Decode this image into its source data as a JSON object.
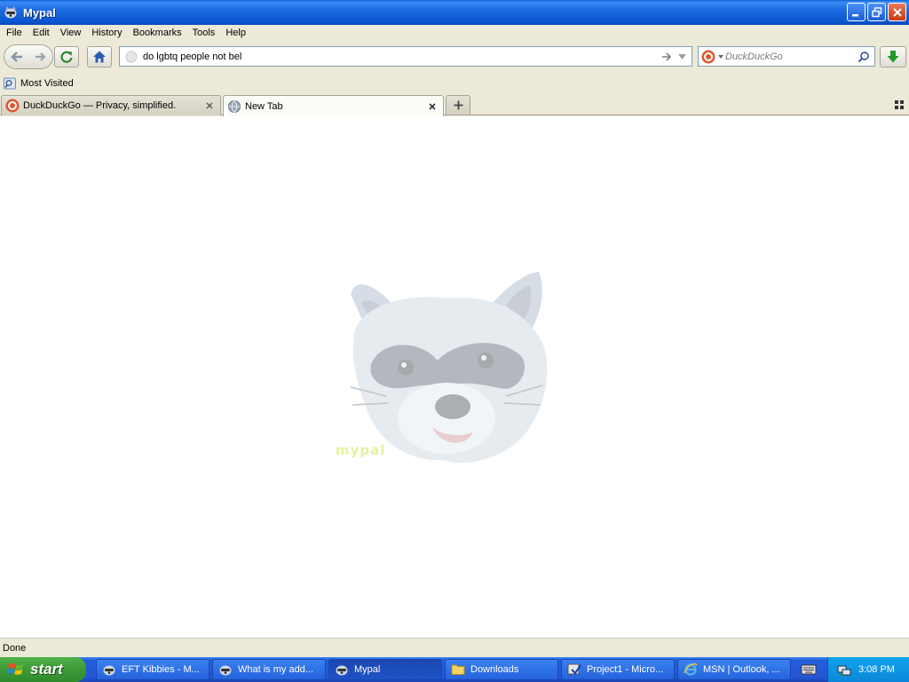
{
  "window": {
    "title": "Mypal"
  },
  "menu": [
    "File",
    "Edit",
    "View",
    "History",
    "Bookmarks",
    "Tools",
    "Help"
  ],
  "navbar": {
    "url_value": "do lgbtq people not bel",
    "search_placeholder": "DuckDuckGo"
  },
  "bookmarks": [
    {
      "label": "Most Visited",
      "icon": "bookmark-folder-icon"
    }
  ],
  "tabs": [
    {
      "label": "DuckDuckGo — Privacy, simplified.",
      "icon": "duckduckgo-icon",
      "active": false
    },
    {
      "label": "New Tab",
      "icon": "globe-icon",
      "active": true
    }
  ],
  "content": {
    "logo_text": "mypal"
  },
  "statusbar": {
    "text": "Done"
  },
  "taskbar": {
    "start_label": "start",
    "tasks": [
      {
        "label": "EFT Kibbies - M...",
        "icon": "mypal-icon"
      },
      {
        "label": "What is my add...",
        "icon": "mypal-icon"
      },
      {
        "label": "Mypal",
        "icon": "mypal-icon",
        "active": true
      },
      {
        "label": "Downloads",
        "icon": "folder-icon"
      },
      {
        "label": "Project1 - Micro...",
        "icon": "vb-project-icon"
      },
      {
        "label": "MSN | Outlook, ...",
        "icon": "ie-icon"
      }
    ],
    "clock": "3:08 PM"
  },
  "colors": {
    "titlebar": "#0a55d0",
    "taskbar": "#245edb",
    "start": "#3c9a38",
    "tray": "#0c86d9"
  }
}
